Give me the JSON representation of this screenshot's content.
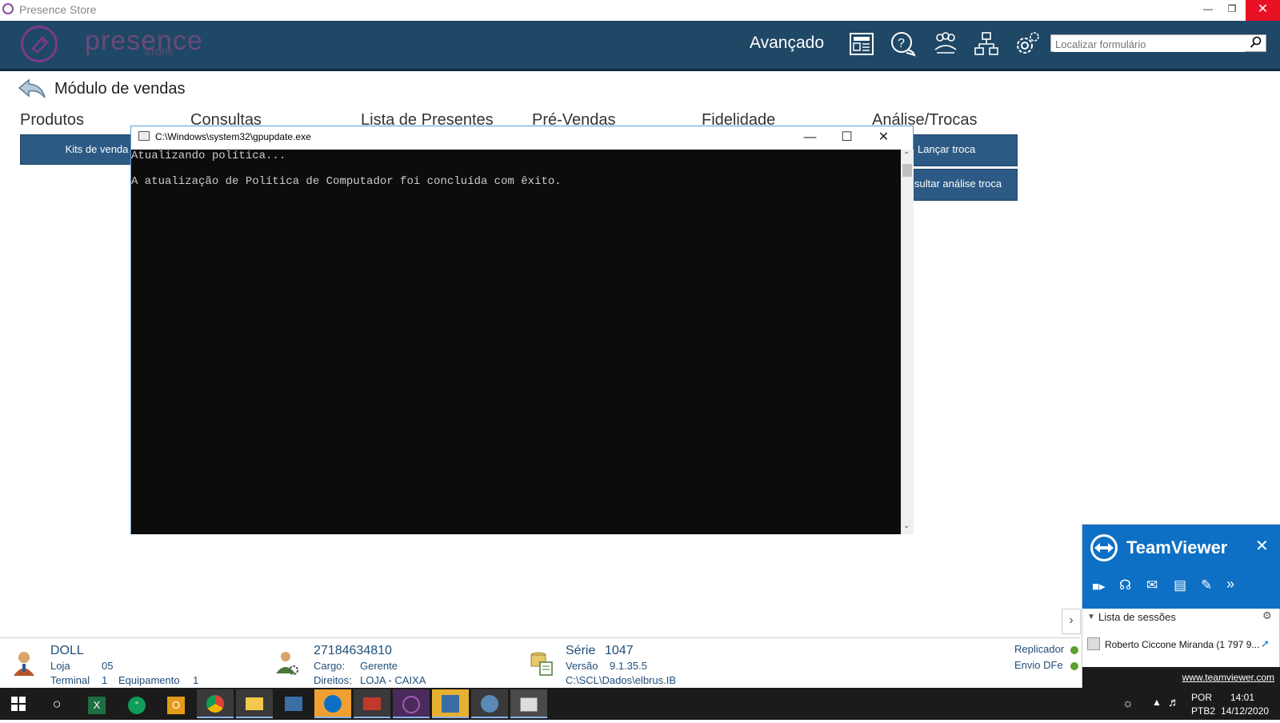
{
  "window": {
    "title": "Presence Store"
  },
  "header": {
    "logo_text": "presence",
    "logo_sub": "STORE",
    "advanced_label": "Avançado",
    "search_placeholder": "Localizar formulário"
  },
  "module": {
    "title": "Módulo de vendas",
    "tabs": [
      "Produtos",
      "Consultas",
      "Lista de Presentes",
      "Pré-Vendas",
      "Fidelidade",
      "Análise/Trocas"
    ],
    "tiles": {
      "kits": "Kits de venda",
      "lancar_troca": "Lançar troca",
      "consultar_analise": "sultar análise troca"
    }
  },
  "console": {
    "title": "C:\\Windows\\system32\\gpupdate.exe",
    "line1": "Atualizando política...",
    "line2": "A atualização de Política de Computador foi concluída com êxito."
  },
  "status": {
    "user": {
      "name": "DOLL",
      "loja_label": "Loja",
      "loja": "05",
      "terminal_label": "Terminal",
      "terminal": "1",
      "equip_label": "Equipamento",
      "equip": "1"
    },
    "role": {
      "cnpj": "27184634810",
      "cargo_label": "Cargo:",
      "cargo": "Gerente",
      "direitos_label": "Direitos:",
      "direitos": "LOJA - CAIXA"
    },
    "system": {
      "serie_label": "Série",
      "serie": "1047",
      "versao_label": "Versão",
      "versao": "9.1.35.5",
      "path": "C:\\SCL\\Dados\\elbrus.IB"
    },
    "replicador": "Replicador",
    "envio_dfe": "Envio DFe"
  },
  "teamviewer": {
    "brand": "TeamViewer",
    "sessions_label": "Lista de sessões",
    "session_user": "Roberto Ciccone Miranda (1 797 9...",
    "link": "www.teamviewer.com"
  },
  "taskbar": {
    "lang": "POR",
    "layout": "PTB2",
    "time": "14:01",
    "date": "14/12/2020"
  },
  "colors": {
    "header_bg": "#1f4766",
    "tile_bg": "#2c5a85",
    "teamviewer_blue": "#0e70c4",
    "console_bg": "#0c0c0c"
  }
}
